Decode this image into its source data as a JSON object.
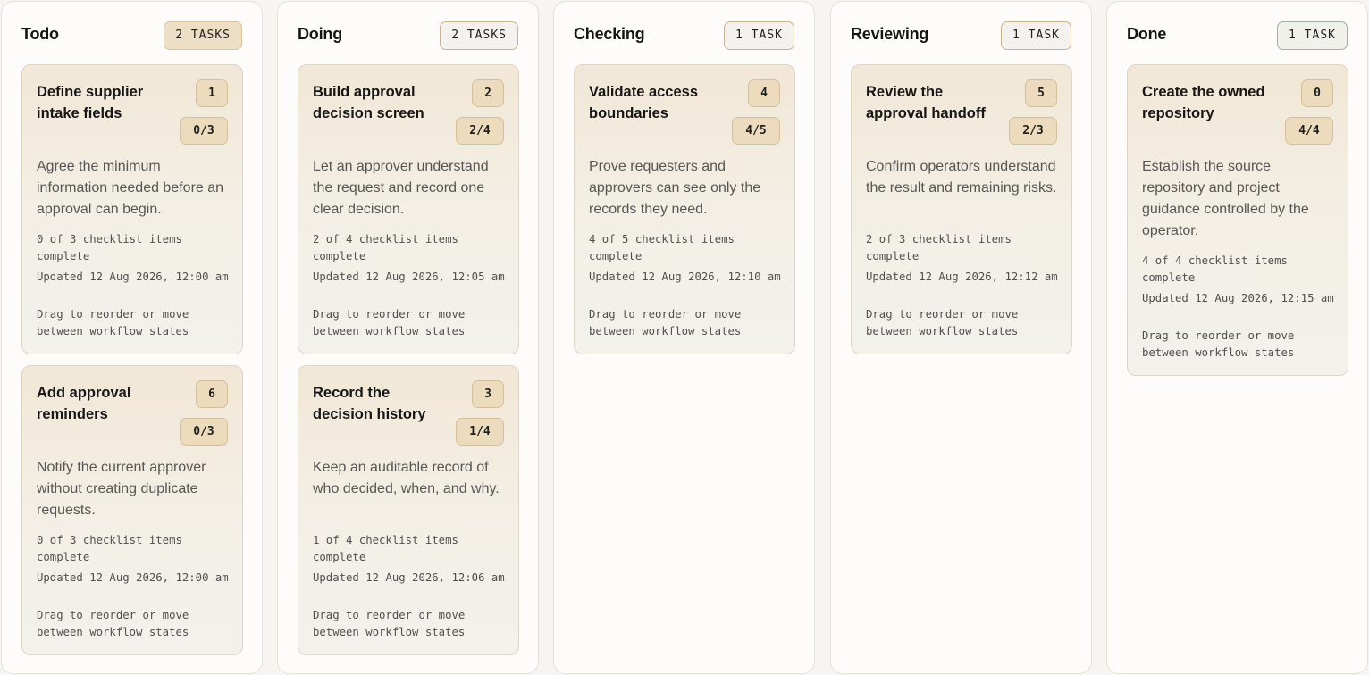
{
  "board": {
    "columns": [
      {
        "title": "Todo",
        "count": "2 TASKS",
        "cards": [
          {
            "title": "Define supplier intake fields",
            "id": "1",
            "progress": "0/3",
            "description": "Agree the minimum information needed before an approval can begin.",
            "checklist": "0 of 3 checklist items complete",
            "updated": "Updated 12 Aug 2026, 12:00 am",
            "hint": "Drag to reorder or move between workflow states"
          },
          {
            "title": "Add approval reminders",
            "id": "6",
            "progress": "0/3",
            "description": "Notify the current approver without creating duplicate requests.",
            "checklist": "0 of 3 checklist items complete",
            "updated": "Updated 12 Aug 2026, 12:00 am",
            "hint": "Drag to reorder or move between workflow states"
          }
        ]
      },
      {
        "title": "Doing",
        "count": "2 TASKS",
        "cards": [
          {
            "title": "Build approval decision screen",
            "id": "2",
            "progress": "2/4",
            "description": "Let an approver understand the request and record one clear decision.",
            "checklist": "2 of 4 checklist items complete",
            "updated": "Updated 12 Aug 2026, 12:05 am",
            "hint": "Drag to reorder or move between workflow states"
          },
          {
            "title": "Record the decision history",
            "id": "3",
            "progress": "1/4",
            "description": "Keep an auditable record of who decided, when, and why.",
            "checklist": "1 of 4 checklist items complete",
            "updated": "Updated 12 Aug 2026, 12:06 am",
            "hint": "Drag to reorder or move between workflow states"
          }
        ]
      },
      {
        "title": "Checking",
        "count": "1 TASK",
        "cards": [
          {
            "title": "Validate access boundaries",
            "id": "4",
            "progress": "4/5",
            "description": "Prove requesters and approvers can see only the records they need.",
            "checklist": "4 of 5 checklist items complete",
            "updated": "Updated 12 Aug 2026, 12:10 am",
            "hint": "Drag to reorder or move between workflow states"
          }
        ]
      },
      {
        "title": "Reviewing",
        "count": "1 TASK",
        "cards": [
          {
            "title": "Review the approval handoff",
            "id": "5",
            "progress": "2/3",
            "description": "Confirm operators understand the result and remaining risks.",
            "checklist": "2 of 3 checklist items complete",
            "updated": "Updated 12 Aug 2026, 12:12 am",
            "hint": "Drag to reorder or move between workflow states"
          }
        ]
      },
      {
        "title": "Done",
        "count": "1 TASK",
        "cards": [
          {
            "title": "Create the owned repository",
            "id": "0",
            "progress": "4/4",
            "description": "Establish the source repository and project guidance controlled by the operator.",
            "checklist": "4 of 4 checklist items complete",
            "updated": "Updated 12 Aug 2026, 12:15 am",
            "hint": "Drag to reorder or move between workflow states"
          }
        ]
      }
    ]
  }
}
